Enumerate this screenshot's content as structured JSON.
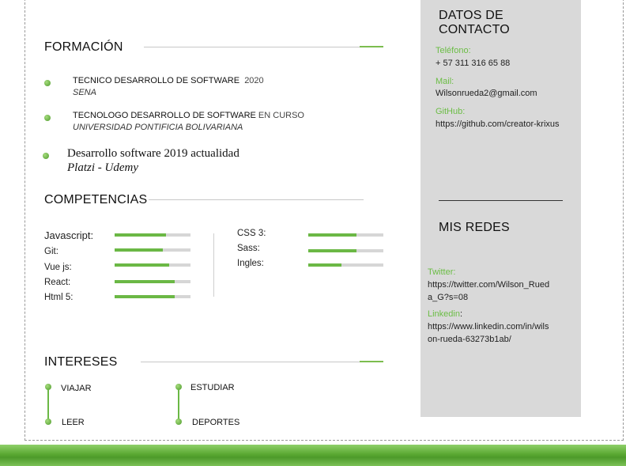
{
  "formacion": {
    "title": "FORMACIÓN",
    "items": [
      {
        "title": "TECNICO DESARROLLO DE SOFTWARE",
        "extra": "2020",
        "school": "SENA"
      },
      {
        "title": "TECNOLOGO DESARROLLO DE SOFTWARE",
        "extra": "EN CURSO",
        "school": "UNIVERSIDAD PONTIFICIA BOLIVARIANA"
      },
      {
        "title": "Desarrollo software 2019 actualidad",
        "school": "Platzi - Udemy"
      }
    ]
  },
  "competencias": {
    "title": "COMPETENCIAS",
    "left": [
      {
        "name": "Javascript:",
        "level": 0.68
      },
      {
        "name": "Git:",
        "level": 0.64
      },
      {
        "name": "Vue js:",
        "level": 0.72
      },
      {
        "name": "React:",
        "level": 0.79
      },
      {
        "name": "Html 5:",
        "level": 0.79
      }
    ],
    "right": [
      {
        "name": "CSS 3:",
        "level": 0.64
      },
      {
        "name": "Sass:",
        "level": 0.64
      },
      {
        "name": "Ingles:",
        "level": 0.44
      }
    ]
  },
  "intereses": {
    "title": "INTERESES",
    "items": [
      "VIAJAR",
      "LEER",
      "ESTUDIAR",
      "DEPORTES"
    ]
  },
  "contacto": {
    "title_line1": "DATOS DE",
    "title_line2": "CONTACTO",
    "phone_label": "Teléfono:",
    "phone": "+ 57 311 316 65 88",
    "mail_label": "Mail:",
    "mail": "Wilsonrueda2@gmail.com",
    "github_label": "GitHub:",
    "github": "https://github.com/creator-krixus"
  },
  "redes": {
    "title": "MIS REDES",
    "twitter_label": "Twitter:",
    "twitter_line1": "https://twitter.com/Wilson_Rued",
    "twitter_line2": "a_G?s=08",
    "linkedin_label": "Linkedin",
    "linkedin_colon": ":",
    "linkedin_line1": "https://www.linkedin.com/in/wils",
    "linkedin_line2": "on-rueda-63273b1ab/"
  },
  "colors": {
    "accent": "#6bb845",
    "sidebar": "#d9d9d9"
  }
}
